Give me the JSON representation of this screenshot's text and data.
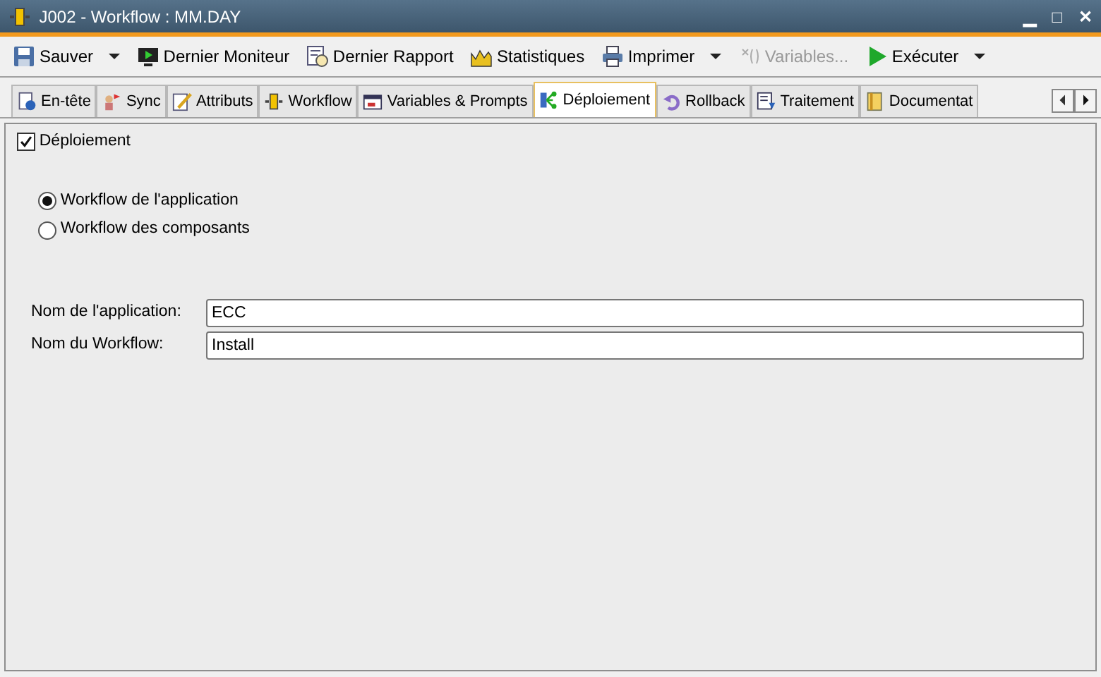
{
  "window": {
    "title": "J002 - Workflow : MM.DAY",
    "controls": [
      "▁",
      "□",
      "✕"
    ]
  },
  "toolbar": [
    {
      "label": "Sauver",
      "dropdown": true,
      "disabled": false
    },
    {
      "label": "Dernier Moniteur",
      "dropdown": false,
      "disabled": false
    },
    {
      "label": "Dernier Rapport",
      "dropdown": false,
      "disabled": false
    },
    {
      "label": "Statistiques",
      "dropdown": false,
      "disabled": false
    },
    {
      "label": "Imprimer",
      "dropdown": true,
      "disabled": false
    },
    {
      "label": "Variables...",
      "dropdown": false,
      "disabled": true
    },
    {
      "label": "Exécuter",
      "dropdown": true,
      "disabled": false
    }
  ],
  "tabs": [
    {
      "label": "En-tête",
      "selected": false
    },
    {
      "label": "Sync",
      "selected": false
    },
    {
      "label": "Attributs",
      "selected": false
    },
    {
      "label": "Workflow",
      "selected": false
    },
    {
      "label": "Variables & Prompts",
      "selected": false
    },
    {
      "label": "Déploiement",
      "selected": true
    },
    {
      "label": "Rollback",
      "selected": false
    },
    {
      "label": "Traitement",
      "selected": false
    },
    {
      "label": "Documentat",
      "selected": false
    }
  ],
  "deployment": {
    "label": "Déploiement",
    "checked": true
  },
  "workflow_type": [
    {
      "label": "Workflow de l'application",
      "selected": true
    },
    {
      "label": "Workflow des composants",
      "selected": false
    }
  ],
  "fields": [
    {
      "label": "Nom de l'application:",
      "value": "ECC"
    },
    {
      "label": "Nom du Workflow:",
      "value": "Install"
    }
  ]
}
